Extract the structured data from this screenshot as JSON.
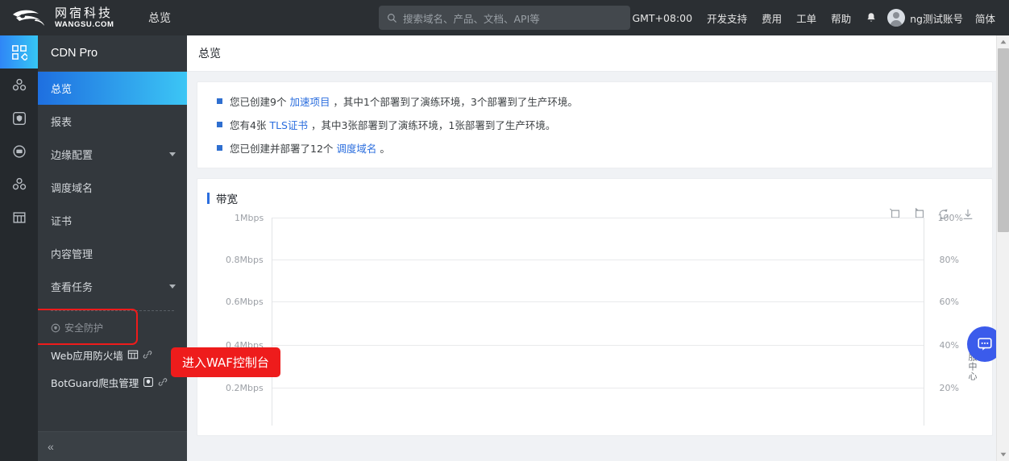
{
  "topbar": {
    "logo_cn": "网宿科技",
    "logo_en": "WANGSU.COM",
    "product": "总览",
    "search_placeholder": "搜索域名、产品、文档、API等",
    "nav": [
      {
        "label": "GMT+08:00"
      },
      {
        "label": "开发支持"
      },
      {
        "label": "费用"
      },
      {
        "label": "工单"
      },
      {
        "label": "帮助"
      }
    ],
    "account_name": "ng测试账号",
    "language": "简体"
  },
  "rail": {
    "items": [
      {
        "icon": "grid-icon",
        "active": true
      },
      {
        "icon": "cluster-icon",
        "active": false
      },
      {
        "icon": "shield-icon",
        "active": false
      },
      {
        "icon": "monitor-icon",
        "active": false
      },
      {
        "icon": "nodes-icon",
        "active": false
      },
      {
        "icon": "storage-icon",
        "active": false
      }
    ]
  },
  "sidebar": {
    "title": "CDN Pro",
    "menu": [
      {
        "label": "总览",
        "active": true,
        "expandable": false
      },
      {
        "label": "报表",
        "active": false,
        "expandable": false
      },
      {
        "label": "边缘配置",
        "active": false,
        "expandable": true
      },
      {
        "label": "调度域名",
        "active": false,
        "expandable": false
      },
      {
        "label": "证书",
        "active": false,
        "expandable": false
      },
      {
        "label": "内容管理",
        "active": false,
        "expandable": false
      },
      {
        "label": "查看任务",
        "active": false,
        "expandable": true
      }
    ],
    "section_label": "安全防护",
    "security_items": [
      {
        "label": "Web应用防火墙",
        "icon": "grid-small-icon",
        "link_icon": "external-link-icon",
        "highlighted": true
      },
      {
        "label": "BotGuard爬虫管理",
        "icon": "shield-small-icon",
        "link_icon": "external-link-icon",
        "highlighted": false
      }
    ],
    "collapse_glyph": "«"
  },
  "callout": {
    "text": "进入WAF控制台",
    "color": "#ee1c1c"
  },
  "page": {
    "title": "总览",
    "notices": [
      {
        "pre": "您已创建9个 ",
        "link": "加速项目",
        "post": " ，其中1个部署到了演练环境，3个部署到了生产环境。"
      },
      {
        "pre": "您有4张 ",
        "link": "TLS证书",
        "post": " ，其中3张部署到了演练环境，1张部署到了生产环境。"
      },
      {
        "pre": "您已创建并部署了12个 ",
        "link": "调度域名",
        "post": " 。"
      }
    ]
  },
  "chart_data": {
    "type": "line",
    "title": "带宽",
    "xlabel": "",
    "ylabel": "",
    "series": [],
    "y_left_ticks": [
      "1Mbps",
      "0.8Mbps",
      "0.6Mbps",
      "0.4Mbps",
      "0.2Mbps"
    ],
    "y_right_ticks": [
      "100%",
      "80%",
      "60%",
      "40%",
      "20%"
    ],
    "ylim": [
      0,
      1
    ],
    "y2lim": [
      0,
      100
    ],
    "grid": true,
    "legend": "none",
    "toolbar": [
      {
        "icon": "zoom-select-icon"
      },
      {
        "icon": "zoom-restore-icon"
      },
      {
        "icon": "refresh-icon"
      },
      {
        "icon": "download-icon"
      }
    ]
  },
  "chat_widget": {
    "label": "客服中心",
    "icon": "chat-icon",
    "color": "#3b5beb"
  }
}
